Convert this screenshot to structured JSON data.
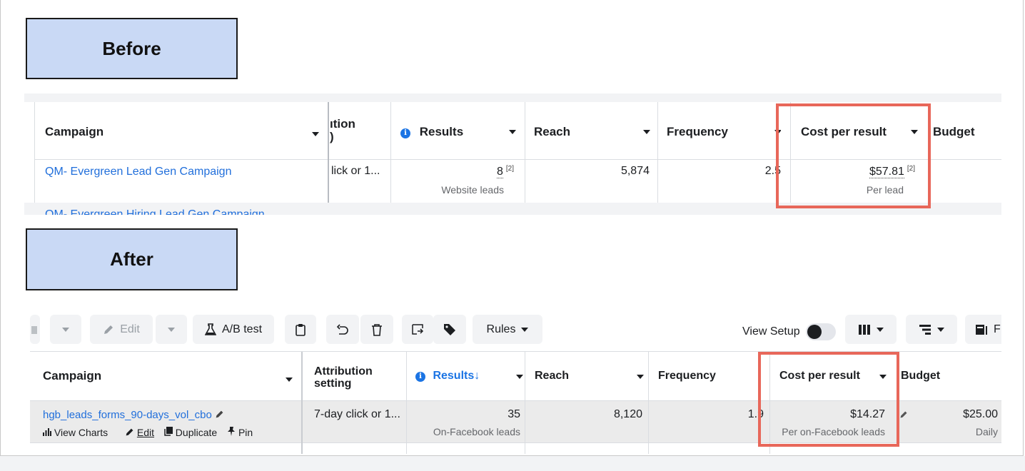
{
  "labels": {
    "before": "Before",
    "after": "After"
  },
  "before": {
    "headers": {
      "campaign": "Campaign",
      "attribution": "ıtion",
      "attribution_line2": ")",
      "results": "Results",
      "reach": "Reach",
      "frequency": "Frequency",
      "cost_per_result": "Cost per result",
      "budget": "Budget"
    },
    "row": {
      "campaign": "QM- Evergreen Lead Gen Campaign",
      "attribution": "lick or 1...",
      "results": "8",
      "results_sup": "[2]",
      "results_sub": "Website leads",
      "reach": "5,874",
      "frequency": "2.5",
      "cost": "$57.81",
      "cost_sup": "[2]",
      "cost_sub": "Per lead"
    },
    "next_row_partial": "QM- Evergreen Hiring Lead Gen Campaign"
  },
  "after": {
    "toolbar": {
      "edit": "Edit",
      "ab_test": "A/B test",
      "rules": "Rules",
      "view_setup": "View Setup"
    },
    "headers": {
      "campaign": "Campaign",
      "attribution": "Attribution",
      "attribution_line2": "setting",
      "results": "Results",
      "reach": "Reach",
      "frequency": "Frequency",
      "cost_per_result": "Cost per result",
      "budget": "Budget"
    },
    "row": {
      "campaign": "hgb_leads_forms_90-days_vol_cbo",
      "actions": {
        "view_charts": "View Charts",
        "edit": "Edit",
        "duplicate": "Duplicate",
        "pin": "Pin"
      },
      "attribution": "7-day click or 1...",
      "results": "35",
      "results_sub": "On-Facebook leads",
      "reach": "8,120",
      "frequency": "1.9",
      "cost": "$14.27",
      "cost_sub": "Per on-Facebook leads",
      "budget": "$25.00",
      "budget_sub": "Daily"
    }
  },
  "colors": {
    "highlight": "#e8675a",
    "link": "#216fdb",
    "label_fill": "#c9d9f5"
  },
  "icons": [
    "info-icon",
    "caret-down-icon",
    "pencil-icon",
    "flask-icon",
    "clipboard-icon",
    "undo-icon",
    "trash-icon",
    "export-icon",
    "tag-icon",
    "columns-icon",
    "breakdown-icon",
    "report-icon",
    "chart-icon",
    "pin-icon",
    "duplicate-icon",
    "sort-arrow-icon"
  ]
}
